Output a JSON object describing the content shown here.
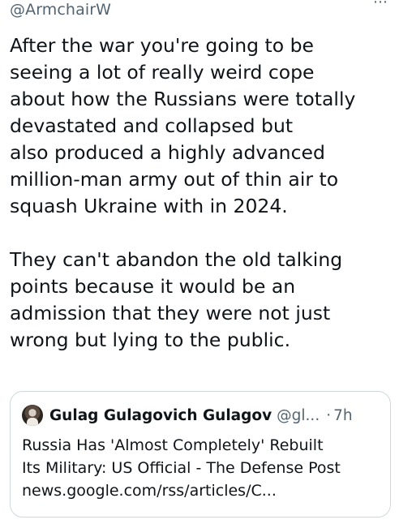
{
  "tweet": {
    "handle": "@ArmchairW",
    "paragraphs": [
      "After the war you're going to be\nseeing a lot of really weird cope\nabout how the Russians were totally\ndevastated and collapsed but\nalso produced a highly advanced\nmillion-man army out of thin air to\nsquash Ukraine with in 2024.",
      "They can't abandon the old talking\npoints because it would be an\nadmission that they were not just\nwrong but lying to the public."
    ]
  },
  "quote": {
    "name": "Gulag Gulagovich Gulagov",
    "handle": "@gl...",
    "separator": "·",
    "time": "7h",
    "lines": [
      "Russia Has 'Almost Completely' Rebuilt",
      "Its Military: US Official - The Defense Post",
      "news.google.com/rss/articles/C..."
    ]
  },
  "icons": {
    "more": "more-dots-icon",
    "avatar": "user-avatar"
  },
  "colors": {
    "text": "#0f1419",
    "secondary": "#536471",
    "border": "#cfd9de",
    "background": "#ffffff"
  }
}
